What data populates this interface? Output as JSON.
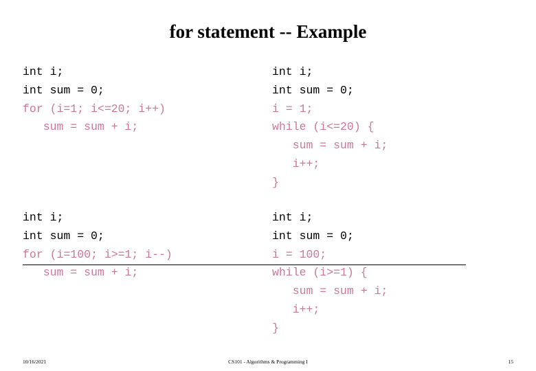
{
  "slide": {
    "title": "for statement -- Example",
    "blocks": [
      {
        "id": "example-1",
        "left": {
          "lines": [
            {
              "text": "int i;",
              "color": "black"
            },
            {
              "text": "int sum = 0;",
              "color": "black"
            },
            {
              "text": "for (i=1; i<=20; i++)",
              "color": "pink"
            },
            {
              "text": "   sum = sum + i;",
              "color": "pink"
            }
          ]
        },
        "right": {
          "lines": [
            {
              "text": "int i;",
              "color": "black"
            },
            {
              "text": "int sum = 0;",
              "color": "black"
            },
            {
              "text": "i = 1;",
              "color": "pink"
            },
            {
              "text": "while (i<=20) {",
              "color": "pink"
            },
            {
              "text": "   sum = sum + i;",
              "color": "pink"
            },
            {
              "text": "   i++;",
              "color": "pink"
            },
            {
              "text": "}",
              "color": "pink"
            }
          ]
        }
      },
      {
        "id": "example-2",
        "left": {
          "lines": [
            {
              "text": "int i;",
              "color": "black"
            },
            {
              "text": "int sum = 0;",
              "color": "black"
            },
            {
              "text": "for (i=100; i>=1; i--)",
              "color": "pink"
            },
            {
              "text": "   sum = sum + i;",
              "color": "pink"
            }
          ]
        },
        "right": {
          "lines": [
            {
              "text": "int i;",
              "color": "black"
            },
            {
              "text": "int sum = 0;",
              "color": "black"
            },
            {
              "text": "i = 100;",
              "color": "pink"
            },
            {
              "text": "while (i>=1) {",
              "color": "pink"
            },
            {
              "text": "   sum = sum + i;",
              "color": "pink"
            },
            {
              "text": "   i++;",
              "color": "pink"
            },
            {
              "text": "}",
              "color": "pink"
            }
          ]
        }
      }
    ]
  },
  "footer": {
    "date": "10/16/2021",
    "course": "CS101 - Algorithms & Programming I",
    "page_number": "15"
  },
  "colors": {
    "code_black": "#000000",
    "code_pink": "#cc7799",
    "background": "#ffffff",
    "divider": "#000000"
  }
}
